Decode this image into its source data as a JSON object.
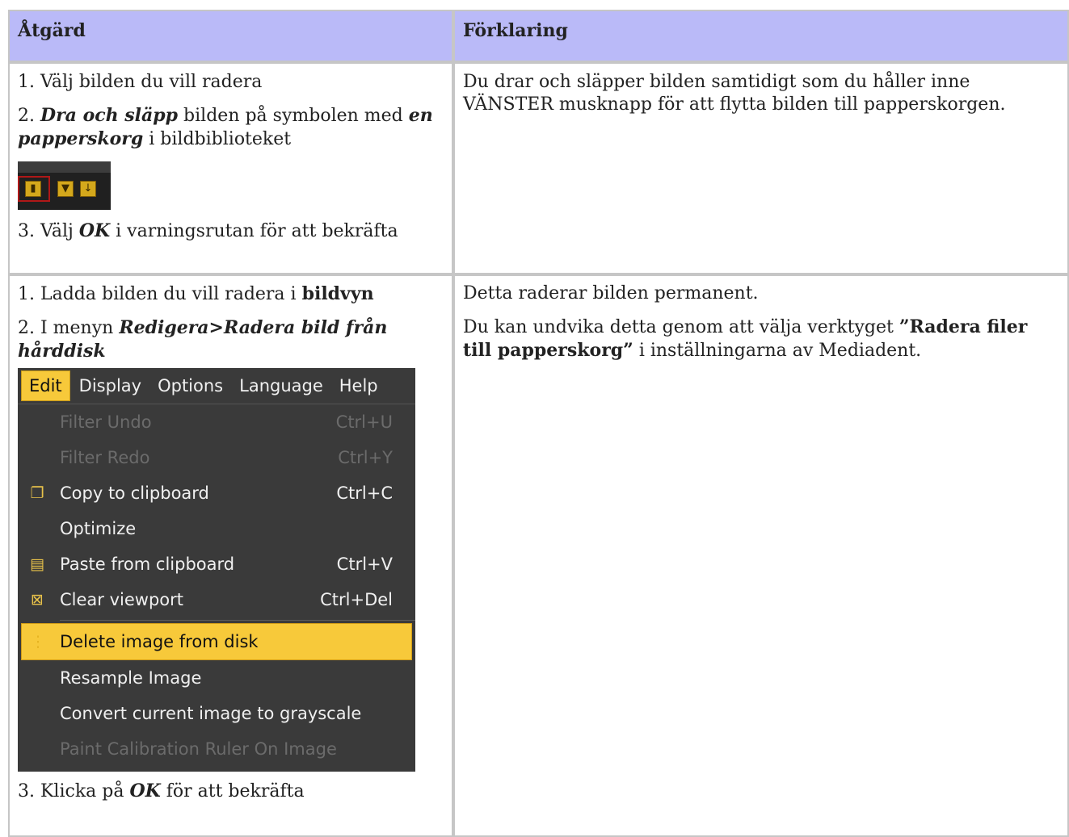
{
  "table": {
    "header": {
      "col1": "Åtgärd",
      "col2": "Förklaring"
    },
    "row1": {
      "step1": "1. Välj bilden du vill radera",
      "step2_prefix": "2. ",
      "step2_bold1": "Dra och släpp",
      "step2_mid": " bilden på symbolen med ",
      "step2_bold2": "en papperskorg",
      "step2_suffix": " i bildbiblioteket",
      "step3_prefix": "3. Välj ",
      "step3_bold": "OK",
      "step3_suffix": " i varningsrutan för att bekräfta",
      "explanation": "Du drar och släpper bilden samtidigt som du håller inne VÄNSTER musknapp för att flytta bilden till papperskorgen."
    },
    "row2": {
      "step1_prefix": "1. Ladda bilden du vill radera i ",
      "step1_bold": "bildvyn",
      "step2_prefix": "2. I menyn ",
      "step2_bold": "Redigera>Radera bild från hårddisk",
      "step3_prefix": "3. Klicka på ",
      "step3_bold": "OK",
      "step3_suffix": " för att bekräfta",
      "explanation1": "Detta raderar bilden permanent.",
      "explanation2_prefix": "Du kan undvika detta genom att välja verktyget ",
      "explanation2_bold": "”Radera filer till papperskorg”",
      "explanation2_suffix": " i inställningarna av Mediadent."
    }
  },
  "menu": {
    "bar": [
      "Edit",
      "Display",
      "Options",
      "Language",
      "Help"
    ],
    "items": [
      {
        "label": "Filter Undo",
        "shortcut": "Ctrl+U"
      },
      {
        "label": "Filter Redo",
        "shortcut": "Ctrl+Y"
      },
      {
        "label": "Copy to clipboard",
        "shortcut": "Ctrl+C"
      },
      {
        "label": "Optimize",
        "shortcut": ""
      },
      {
        "label": "Paste from clipboard",
        "shortcut": "Ctrl+V"
      },
      {
        "label": "Clear viewport",
        "shortcut": "Ctrl+Del"
      },
      {
        "label": "Delete image from disk",
        "shortcut": ""
      },
      {
        "label": "Resample Image",
        "shortcut": ""
      },
      {
        "label": "Convert current image to grayscale",
        "shortcut": ""
      },
      {
        "label": "Paint Calibration Ruler On Image",
        "shortcut": ""
      }
    ]
  },
  "colors": {
    "header_bg": "#babaf8",
    "menu_bg": "#3a3a3a",
    "menu_highlight": "#f7c93a"
  }
}
